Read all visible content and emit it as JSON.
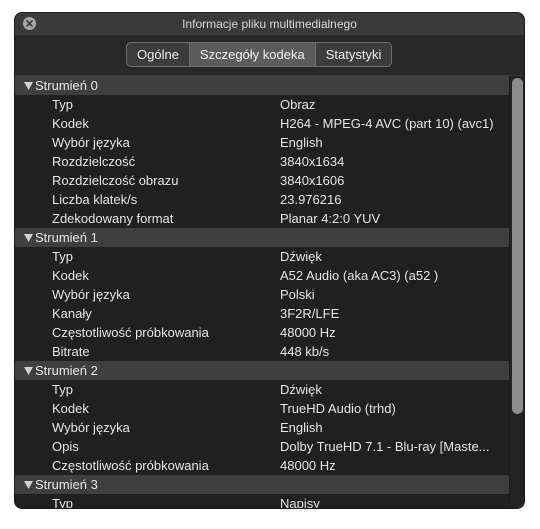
{
  "window": {
    "title": "Informacje pliku multimedialnego"
  },
  "tabs": [
    {
      "label": "Ogólne"
    },
    {
      "label": "Szczegóły kodeka"
    },
    {
      "label": "Statystyki"
    }
  ],
  "streams": [
    {
      "label": "Strumień 0",
      "rows": [
        {
          "key": "Typ",
          "value": "Obraz"
        },
        {
          "key": "Kodek",
          "value": "H264 - MPEG-4 AVC (part 10) (avc1)"
        },
        {
          "key": "Wybór języka",
          "value": "English"
        },
        {
          "key": "Rozdzielczość",
          "value": "3840x1634"
        },
        {
          "key": "Rozdzielczość obrazu",
          "value": "3840x1606"
        },
        {
          "key": "Liczba klatek/s",
          "value": "23.976216"
        },
        {
          "key": "Zdekodowany format",
          "value": "Planar 4:2:0 YUV"
        }
      ]
    },
    {
      "label": "Strumień 1",
      "rows": [
        {
          "key": "Typ",
          "value": "Dźwięk"
        },
        {
          "key": "Kodek",
          "value": "A52 Audio (aka AC3) (a52 )"
        },
        {
          "key": "Wybór języka",
          "value": "Polski"
        },
        {
          "key": "Kanały",
          "value": "3F2R/LFE"
        },
        {
          "key": "Częstotliwość próbkowania",
          "value": "48000 Hz"
        },
        {
          "key": "Bitrate",
          "value": "448 kb/s"
        }
      ]
    },
    {
      "label": "Strumień 2",
      "rows": [
        {
          "key": "Typ",
          "value": "Dźwięk"
        },
        {
          "key": "Kodek",
          "value": "TrueHD Audio (trhd)"
        },
        {
          "key": "Wybór języka",
          "value": "English"
        },
        {
          "key": "Opis",
          "value": "Dolby TrueHD 7.1 - Blu-ray [Maste..."
        },
        {
          "key": "Częstotliwość próbkowania",
          "value": "48000 Hz"
        }
      ]
    },
    {
      "label": "Strumień 3",
      "rows": [
        {
          "key": "Typ",
          "value": "Napisy"
        }
      ]
    }
  ]
}
